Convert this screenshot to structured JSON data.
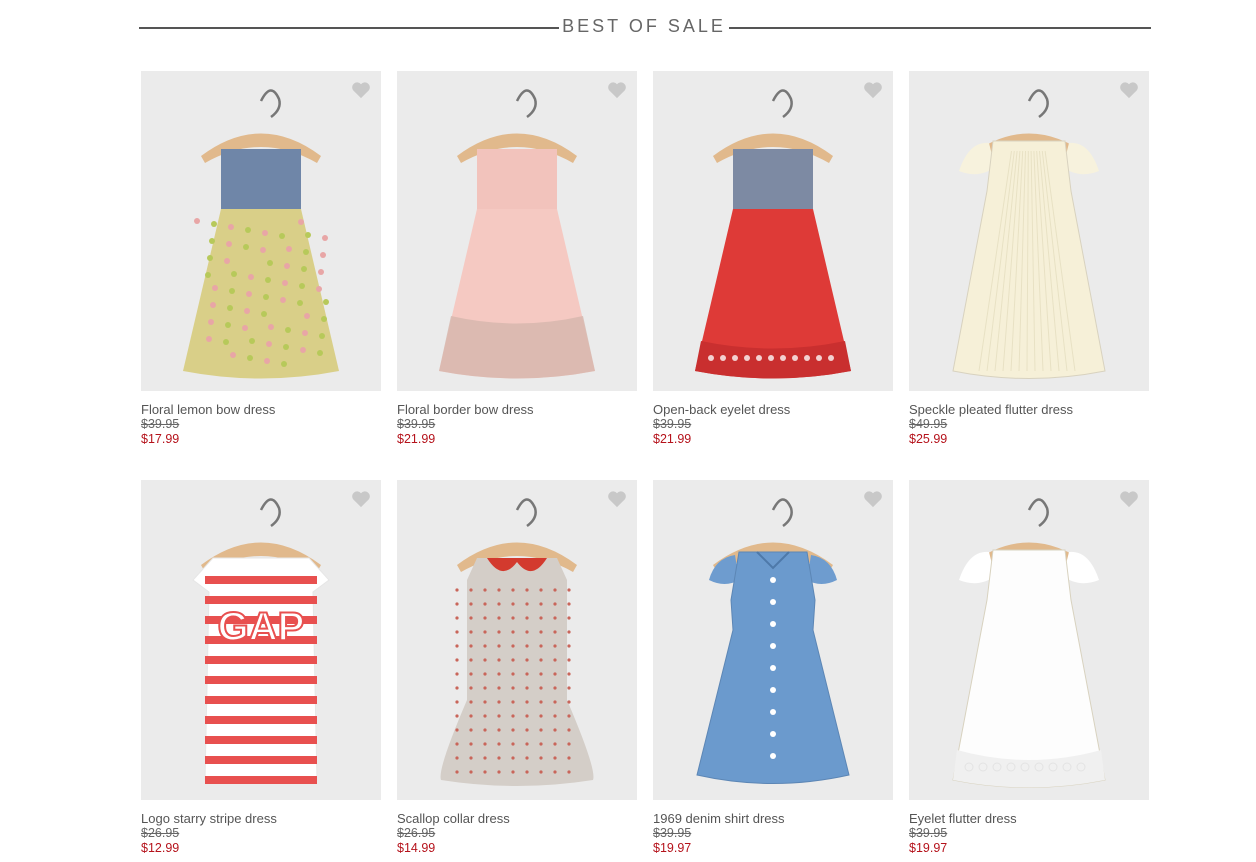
{
  "section": {
    "title": "BEST OF SALE"
  },
  "products": [
    {
      "name": "Floral lemon bow dress",
      "was": "$39.95",
      "now": "$17.99",
      "icon": "floral-dress-icon",
      "colors": {
        "top": "#6f86a8",
        "skirt": "#d9cf88",
        "accent": "#b7c95a"
      }
    },
    {
      "name": "Floral border bow dress",
      "was": "$39.95",
      "now": "$21.99",
      "icon": "pink-dress-icon",
      "colors": {
        "top": "#f2c3bc",
        "skirt": "#f5c9c2",
        "accent": "#d6b7ad"
      }
    },
    {
      "name": "Open-back eyelet dress",
      "was": "$39.95",
      "now": "$21.99",
      "icon": "red-eyelet-dress-icon",
      "colors": {
        "top": "#7d8aa3",
        "skirt": "#de3a37",
        "accent": "#c92f2f"
      }
    },
    {
      "name": "Speckle pleated flutter dress",
      "was": "$49.95",
      "now": "$25.99",
      "icon": "cream-pleated-dress-icon",
      "colors": {
        "top": "#f7f2dd",
        "skirt": "#f6f0d8",
        "accent": "#e8e1c4"
      }
    },
    {
      "name": "Logo starry stripe dress",
      "was": "$26.95",
      "now": "$12.99",
      "icon": "striped-logo-dress-icon",
      "colors": {
        "top": "#ffffff",
        "skirt": "#ffffff",
        "accent": "#e8504f"
      }
    },
    {
      "name": "Scallop collar dress",
      "was": "$26.95",
      "now": "$14.99",
      "icon": "polka-dot-dress-icon",
      "colors": {
        "top": "#d7d1cb",
        "skirt": "#d4cec8",
        "accent": "#d33a2e"
      }
    },
    {
      "name": "1969 denim shirt dress",
      "was": "$39.95",
      "now": "$19.97",
      "icon": "denim-dress-icon",
      "colors": {
        "top": "#6e9ccf",
        "skirt": "#6b9acd",
        "accent": "#ffffff"
      }
    },
    {
      "name": "Eyelet flutter dress",
      "was": "$39.95",
      "now": "$19.97",
      "icon": "white-eyelet-dress-icon",
      "colors": {
        "top": "#ffffff",
        "skirt": "#fdfdfd",
        "accent": "#e3e3e3"
      }
    }
  ]
}
